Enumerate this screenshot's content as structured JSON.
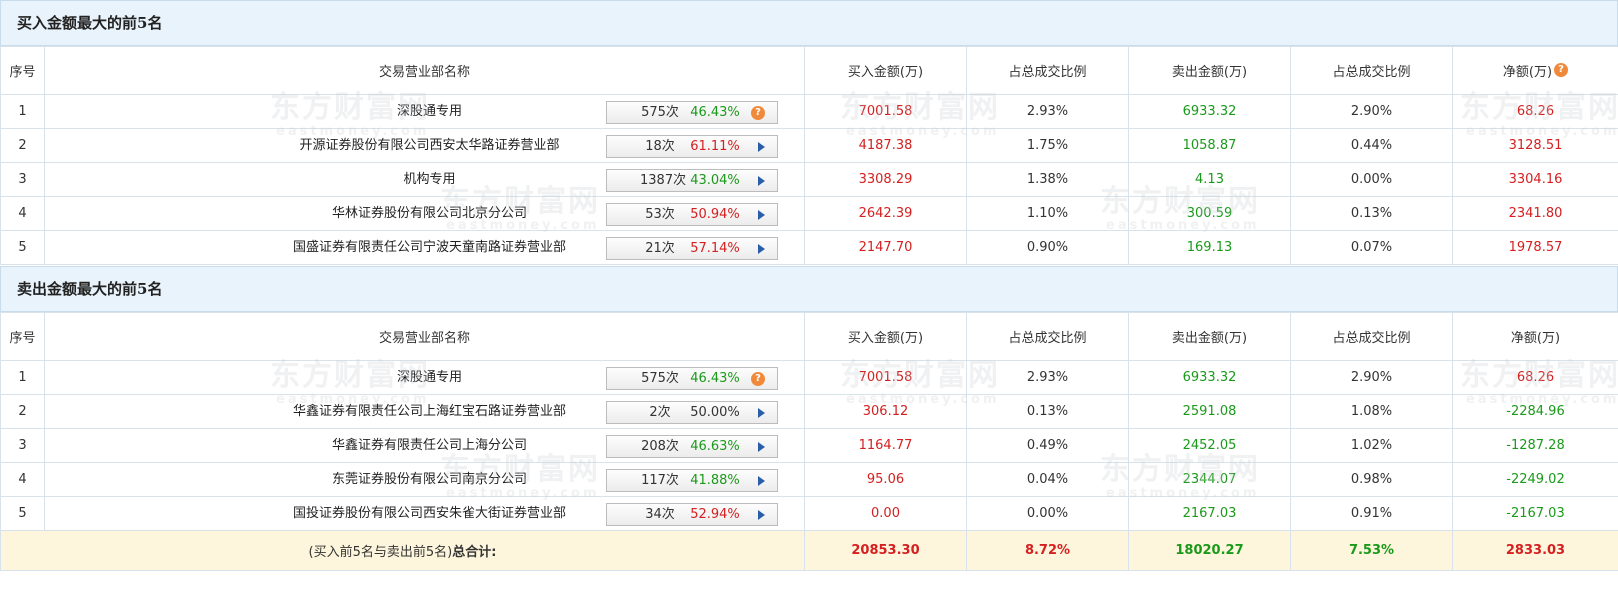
{
  "buy_section": {
    "title": "买入金额最大的前5名",
    "headers": [
      "序号",
      "交易营业部名称",
      "买入金额(万)",
      "占总成交比例",
      "卖出金额(万)",
      "占总成交比例",
      "净额(万)"
    ],
    "rows": [
      {
        "idx": "1",
        "name": "深股通专用",
        "count": "575次",
        "rate": "46.43%",
        "rate_color": "green",
        "icon": "question",
        "buy": "7001.58",
        "buy_pct": "2.93%",
        "sell": "6933.32",
        "sell_pct": "2.90%",
        "net": "68.26"
      },
      {
        "idx": "2",
        "name": "开源证券股份有限公司西安太华路证券营业部",
        "count": "18次",
        "rate": "61.11%",
        "rate_color": "red",
        "icon": "arrow",
        "buy": "4187.38",
        "buy_pct": "1.75%",
        "sell": "1058.87",
        "sell_pct": "0.44%",
        "net": "3128.51"
      },
      {
        "idx": "3",
        "name": "机构专用",
        "count": "1387次",
        "rate": "43.04%",
        "rate_color": "green",
        "icon": "arrow",
        "buy": "3308.29",
        "buy_pct": "1.38%",
        "sell": "4.13",
        "sell_pct": "0.00%",
        "net": "3304.16"
      },
      {
        "idx": "4",
        "name": "华林证券股份有限公司北京分公司",
        "count": "53次",
        "rate": "50.94%",
        "rate_color": "red",
        "icon": "arrow",
        "buy": "2642.39",
        "buy_pct": "1.10%",
        "sell": "300.59",
        "sell_pct": "0.13%",
        "net": "2341.80"
      },
      {
        "idx": "5",
        "name": "国盛证券有限责任公司宁波天童南路证券营业部",
        "count": "21次",
        "rate": "57.14%",
        "rate_color": "red",
        "icon": "arrow",
        "buy": "2147.70",
        "buy_pct": "0.90%",
        "sell": "169.13",
        "sell_pct": "0.07%",
        "net": "1978.57"
      }
    ]
  },
  "sell_section": {
    "title": "卖出金额最大的前5名",
    "headers": [
      "序号",
      "交易营业部名称",
      "买入金额(万)",
      "占总成交比例",
      "卖出金额(万)",
      "占总成交比例",
      "净额(万)"
    ],
    "rows": [
      {
        "idx": "1",
        "name": "深股通专用",
        "count": "575次",
        "rate": "46.43%",
        "rate_color": "green",
        "icon": "question",
        "buy": "7001.58",
        "buy_pct": "2.93%",
        "sell": "6933.32",
        "sell_pct": "2.90%",
        "net": "68.26"
      },
      {
        "idx": "2",
        "name": "华鑫证券有限责任公司上海红宝石路证券营业部",
        "count": "2次",
        "rate": "50.00%",
        "rate_color": "dark",
        "icon": "arrow",
        "buy": "306.12",
        "buy_pct": "0.13%",
        "sell": "2591.08",
        "sell_pct": "1.08%",
        "net": "-2284.96"
      },
      {
        "idx": "3",
        "name": "华鑫证券有限责任公司上海分公司",
        "count": "208次",
        "rate": "46.63%",
        "rate_color": "green",
        "icon": "arrow",
        "buy": "1164.77",
        "buy_pct": "0.49%",
        "sell": "2452.05",
        "sell_pct": "1.02%",
        "net": "-1287.28"
      },
      {
        "idx": "4",
        "name": "东莞证券股份有限公司南京分公司",
        "count": "117次",
        "rate": "41.88%",
        "rate_color": "green",
        "icon": "arrow",
        "buy": "95.06",
        "buy_pct": "0.04%",
        "sell": "2344.07",
        "sell_pct": "0.98%",
        "net": "-2249.02"
      },
      {
        "idx": "5",
        "name": "国投证券股份有限公司西安朱雀大街证券营业部",
        "count": "34次",
        "rate": "52.94%",
        "rate_color": "red",
        "icon": "arrow",
        "buy": "0.00",
        "buy_pct": "0.00%",
        "sell": "2167.03",
        "sell_pct": "0.91%",
        "net": "-2167.03"
      }
    ],
    "total": {
      "label_prefix": "(买入前5名与卖出前5名)",
      "label_bold": "总合计:",
      "buy": "20853.30",
      "buy_pct": "8.72%",
      "sell": "18020.27",
      "sell_pct": "7.53%",
      "net": "2833.03"
    }
  },
  "watermark": {
    "cn": "东方财富网",
    "en": "eastmoney.com"
  },
  "colors": {
    "red": "#d42020",
    "green": "#1a9a1a",
    "header_bg": "#e9f3fb",
    "total_bg": "#fdf6dc",
    "help_icon": "#f08a3a",
    "arrow_icon": "#2a5ea8"
  }
}
